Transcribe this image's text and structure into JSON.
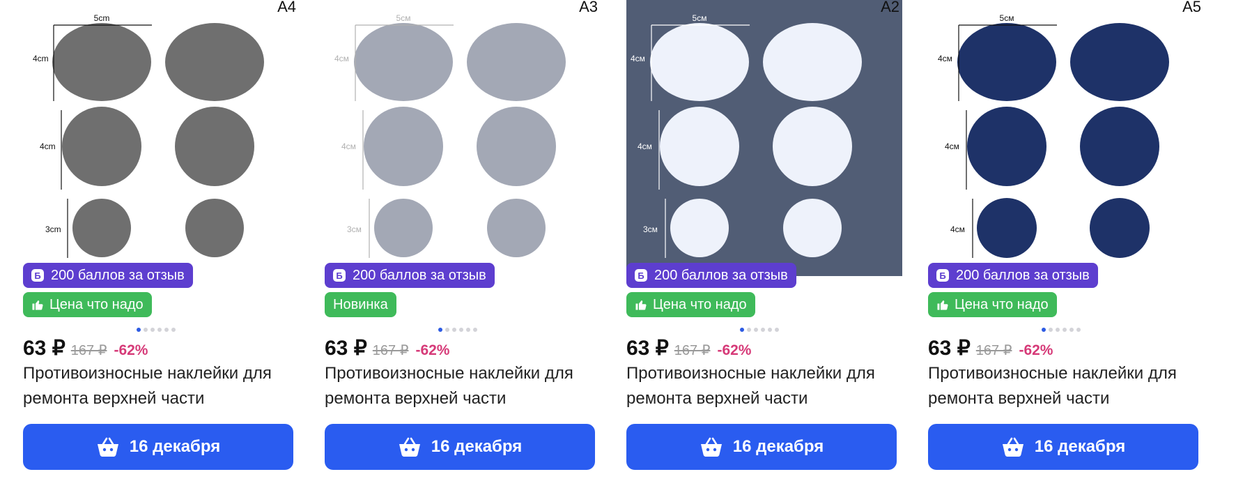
{
  "products": [
    {
      "size_label": "A4",
      "image": {
        "bg": "#ffffff",
        "patch_color": "#6f6f6f",
        "dim_color": "#111111",
        "dims": [
          "5cm",
          "4cm",
          "4cm",
          "3cm"
        ]
      },
      "points_badge": "200 баллов за отзыв",
      "points_icon": "Б",
      "tag": "Цена что надо",
      "tag_icon": "thumbs-up",
      "price": "63 ₽",
      "old_price": "167 ₽",
      "discount": "-62%",
      "title": "Противоизносные наклейки для ремонта верхней части",
      "button": "16 декабря",
      "slides": 6,
      "active_slide": 0
    },
    {
      "size_label": "A3",
      "image": {
        "bg": "#ffffff",
        "patch_color": "#a3a8b5",
        "dim_color": "#b0b0b0",
        "dims": [
          "5см",
          "4см",
          "4см",
          "3см"
        ]
      },
      "points_badge": "200 баллов за отзыв",
      "points_icon": "Б",
      "tag": "Новинка",
      "tag_icon": "",
      "price": "63 ₽",
      "old_price": "167 ₽",
      "discount": "-62%",
      "title": "Противоизносные наклейки для ремонта верхней части",
      "button": "16 декабря",
      "slides": 6,
      "active_slide": 0
    },
    {
      "size_label": "A2",
      "image": {
        "bg": "#515d75",
        "patch_color": "#eef2fb",
        "dim_color": "#ffffff",
        "dims": [
          "5см",
          "4см",
          "4см",
          "3см"
        ]
      },
      "points_badge": "200 баллов за отзыв",
      "points_icon": "Б",
      "tag": "Цена что надо",
      "tag_icon": "thumbs-up",
      "price": "63 ₽",
      "old_price": "167 ₽",
      "discount": "-62%",
      "title": "Противоизносные наклейки для ремонта верхней части",
      "button": "16 декабря",
      "slides": 6,
      "active_slide": 0
    },
    {
      "size_label": "A5",
      "image": {
        "bg": "#ffffff",
        "patch_color": "#1e3268",
        "dim_color": "#111111",
        "dims": [
          "5см",
          "4см",
          "4см",
          "4см"
        ]
      },
      "points_badge": "200 баллов за отзыв",
      "points_icon": "Б",
      "tag": "Цена что надо",
      "tag_icon": "thumbs-up",
      "price": "63 ₽",
      "old_price": "167 ₽",
      "discount": "-62%",
      "title": "Противоизносные наклейки для ремонта верхней части",
      "button": "16 декабря",
      "slides": 6,
      "active_slide": 0
    }
  ],
  "colors": {
    "points_badge": "#5d3ecf",
    "tag_green": "#3fba5a",
    "button": "#2a5cf0",
    "discount": "#d63a78",
    "dot_active": "#2d5be3"
  }
}
